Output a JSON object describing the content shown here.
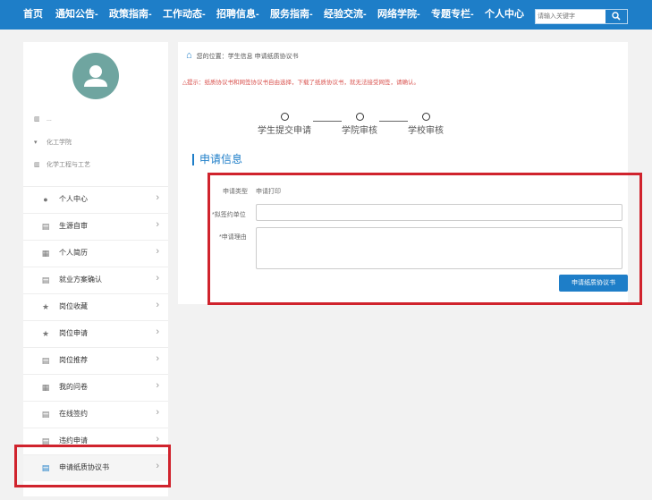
{
  "nav": {
    "items": [
      "首页",
      "通知公告-",
      "政策指南-",
      "工作动态-",
      "招聘信息-",
      "服务指南-",
      "经验交流-",
      "网络学院-",
      "专题专栏-",
      "个人中心"
    ],
    "search_placeholder": "请输入关键字"
  },
  "sidebar": {
    "user_name": "...",
    "college": "化工学院",
    "major": "化学工程与工艺",
    "menu": [
      {
        "label": "个人中心",
        "icon": "user-icon"
      },
      {
        "label": "生源自审",
        "icon": "card-icon"
      },
      {
        "label": "个人简历",
        "icon": "document-icon"
      },
      {
        "label": "就业方案确认",
        "icon": "card-icon"
      },
      {
        "label": "岗位收藏",
        "icon": "star-icon"
      },
      {
        "label": "岗位申请",
        "icon": "star-icon"
      },
      {
        "label": "岗位推荐",
        "icon": "card-icon"
      },
      {
        "label": "我的问卷",
        "icon": "document-icon"
      },
      {
        "label": "在线签约",
        "icon": "card-icon"
      },
      {
        "label": "违约申请",
        "icon": "card-icon"
      },
      {
        "label": "申请纸质协议书",
        "icon": "card-icon"
      }
    ]
  },
  "main": {
    "breadcrumb": "您的位置：学生信息 申请纸质协议书",
    "notice": "△提示：纸质协议书和网签协议书自由选择，下载了纸质协议书，就无法接受网签，请确认。",
    "steps": [
      "学生提交申请",
      "学院审核",
      "学校审核"
    ],
    "section_title": "申请信息",
    "form": {
      "type_label": "申请类型",
      "type_value": "申请打印",
      "unit_label": "*拟签约单位",
      "unit_value": "",
      "reason_label": "*申请理由",
      "reason_value": "",
      "submit_label": "申请纸质协议书"
    }
  },
  "colors": {
    "nav_bg": "#1e7ec8",
    "accent": "#1e7ec8",
    "highlight_red": "#d0232d",
    "notice_red": "#d9534f",
    "avatar_bg": "#6fa5a0"
  }
}
